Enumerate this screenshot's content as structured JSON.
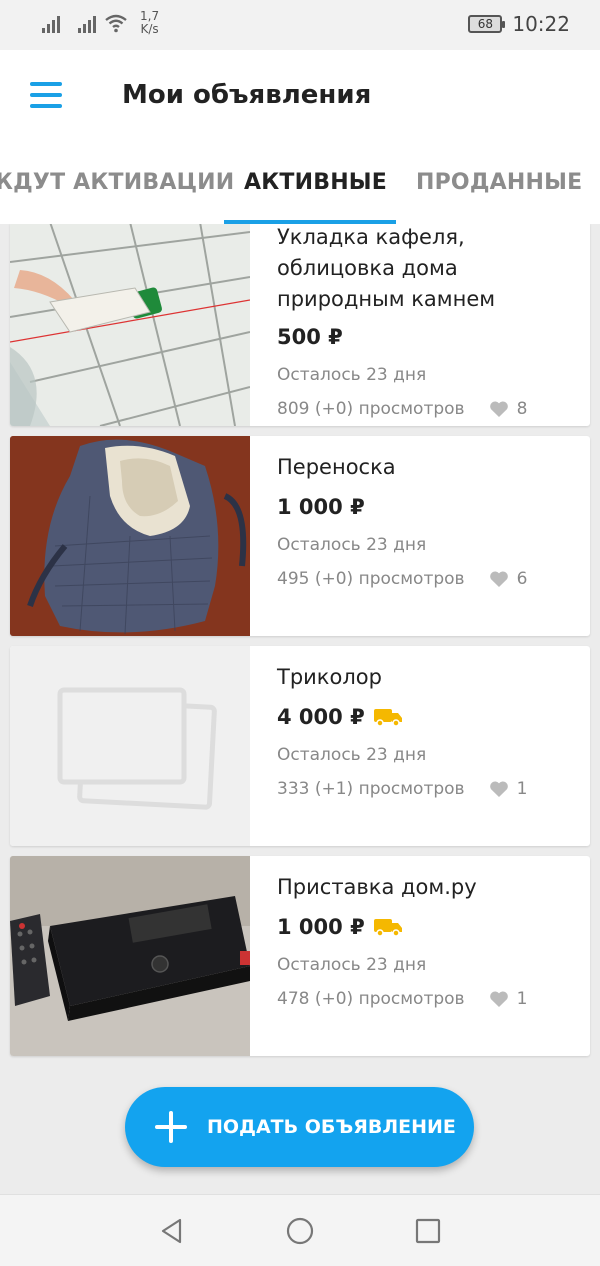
{
  "status_bar": {
    "speed_value": "1,7",
    "speed_unit": "K/s",
    "battery": "68",
    "time": "10:22"
  },
  "app_bar": {
    "title": "Мои объявления",
    "menu_icon": "hamburger-menu-icon"
  },
  "tabs": [
    {
      "label": "ЖДУТ АКТИВАЦИИ",
      "active": false
    },
    {
      "label": "АКТИВНЫЕ",
      "active": true
    },
    {
      "label": "ПРОДАННЫЕ",
      "active": false
    }
  ],
  "listings": [
    {
      "title": "Укладка кафеля, облицовка дома природным камнем",
      "price": "500 ₽",
      "delivery": false,
      "remaining": "Осталось 23 дня",
      "views": "809 (+0) просмотров",
      "likes": "8",
      "image": "tile-laying-photo"
    },
    {
      "title": "Переноска",
      "price": "1 000 ₽",
      "delivery": false,
      "remaining": "Осталось 23 дня",
      "views": "495 (+0) просмотров",
      "likes": "6",
      "image": "baby-carrier-photo"
    },
    {
      "title": "Триколор",
      "price": "4 000 ₽",
      "delivery": true,
      "remaining": "Осталось 23 дня",
      "views": "333 (+1) просмотров",
      "likes": "1",
      "image": "no-photo-placeholder"
    },
    {
      "title": "Приставка дом.ру",
      "price": "1 000 ₽",
      "delivery": true,
      "remaining": "Осталось 23 дня",
      "views": "478 (+0) просмотров",
      "likes": "1",
      "image": "tv-box-photo"
    }
  ],
  "fab": {
    "label": "ПОДАТЬ ОБЪЯВЛЕНИЕ",
    "icon": "plus-icon"
  },
  "colors": {
    "accent": "#1aa0e6",
    "fab": "#13a3ef",
    "delivery": "#f5b800"
  }
}
